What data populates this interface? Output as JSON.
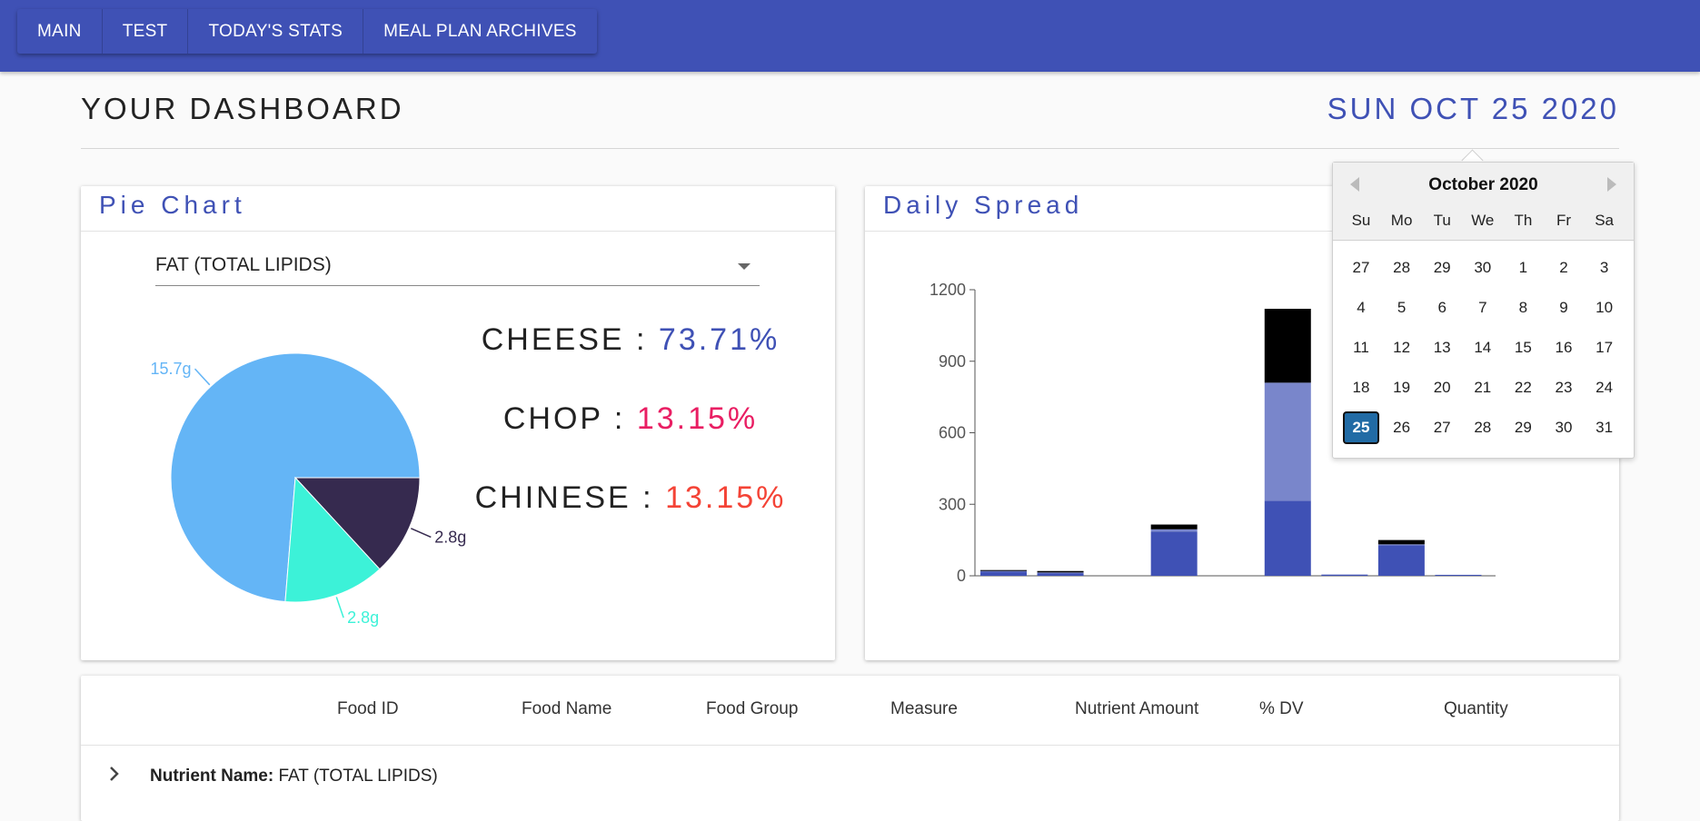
{
  "nav": {
    "items": [
      "MAIN",
      "TEST",
      "TODAY'S STATS",
      "MEAL PLAN ARCHIVES"
    ]
  },
  "header": {
    "title": "YOUR DASHBOARD",
    "date": "SUN OCT 25 2020"
  },
  "pie_card": {
    "title": "Pie Chart",
    "select_value": "FAT (TOTAL LIPIDS)",
    "legend": [
      {
        "name": "CHEESE",
        "sep": " : ",
        "pct": "73.71%",
        "color": "#3f51b5"
      },
      {
        "name": "CHOP",
        "sep": " : ",
        "pct": "13.15%",
        "color": "#e91e63"
      },
      {
        "name": "CHINESE",
        "sep": " : ",
        "pct": "13.15%",
        "color": "#f44336"
      }
    ]
  },
  "spread_card": {
    "title": "Daily Spread"
  },
  "chart_data": [
    {
      "type": "pie",
      "title": "",
      "slices": [
        {
          "label": "15.7g",
          "value": 15.7,
          "color": "#64b5f6"
        },
        {
          "label": "2.8g",
          "value": 2.8,
          "color": "#362a4f"
        },
        {
          "label": "2.8g",
          "value": 2.8,
          "color": "#3cf2d8"
        }
      ]
    },
    {
      "type": "bar",
      "stacked": true,
      "title": "",
      "xlabel": "",
      "ylabel": "",
      "ylim": [
        0,
        1200
      ],
      "yticks": [
        0,
        300,
        600,
        900,
        1200
      ],
      "series": [
        {
          "color": "#3f51b5",
          "values": [
            18,
            12,
            0,
            185,
            0,
            315,
            5,
            128,
            4
          ]
        },
        {
          "color": "#7986cb",
          "values": [
            4,
            2,
            0,
            10,
            0,
            495,
            0,
            4,
            0
          ]
        },
        {
          "color": "#000000",
          "values": [
            2,
            6,
            0,
            20,
            0,
            310,
            0,
            18,
            0
          ]
        }
      ]
    }
  ],
  "table": {
    "headers": [
      "Food ID",
      "Food Name",
      "Food Group",
      "Measure",
      "Nutrient Amount",
      "% DV",
      "Quantity"
    ],
    "expand_icon": "chevron-right-icon",
    "row_label": "Nutrient Name:",
    "row_value": " FAT (TOTAL LIPIDS)"
  },
  "datepicker": {
    "month": "October 2020",
    "weekdays": [
      "Su",
      "Mo",
      "Tu",
      "We",
      "Th",
      "Fr",
      "Sa"
    ],
    "weeks": [
      [
        "27",
        "28",
        "29",
        "30",
        "1",
        "2",
        "3"
      ],
      [
        "4",
        "5",
        "6",
        "7",
        "8",
        "9",
        "10"
      ],
      [
        "11",
        "12",
        "13",
        "14",
        "15",
        "16",
        "17"
      ],
      [
        "18",
        "19",
        "20",
        "21",
        "22",
        "23",
        "24"
      ],
      [
        "25",
        "26",
        "27",
        "28",
        "29",
        "30",
        "31"
      ]
    ],
    "selected": "25",
    "accent": "#216ba5"
  }
}
